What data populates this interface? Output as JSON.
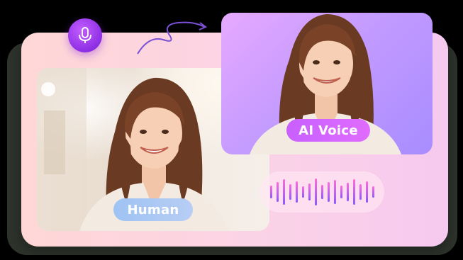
{
  "labels": {
    "human": "Human",
    "ai_voice": "AI Voice"
  },
  "icons": {
    "mic": "microphone-icon",
    "arrow": "curved-arrow-icon",
    "waveform": "audio-waveform-icon"
  },
  "colors": {
    "background": "#000000",
    "card": "#fbd3e6",
    "accent_purple": "#8a2be2",
    "ai_badge": "#d466ff",
    "human_badge": "#a9c8f4",
    "ai_photo_bg": "#c49bff"
  },
  "waveform_levels": [
    0.45,
    0.7,
    0.9,
    0.55,
    0.75,
    0.4,
    0.6,
    0.95,
    0.5,
    0.7,
    0.85,
    0.45,
    0.65,
    0.9,
    0.55,
    0.75,
    0.4
  ]
}
